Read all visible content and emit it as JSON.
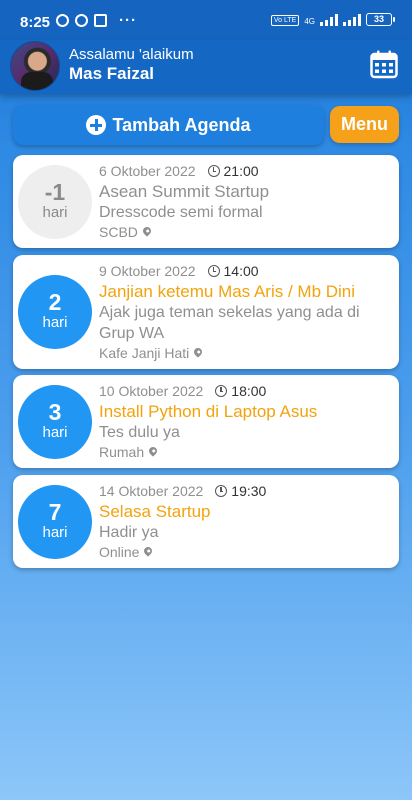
{
  "status_bar": {
    "time": "8:25",
    "network": "4G",
    "volte": "Vo LTE",
    "battery": "33"
  },
  "header": {
    "greeting": "Assalamu 'alaikum",
    "username": "Mas Faizal",
    "calendar_icon": "calendar-icon"
  },
  "actions": {
    "add_label": "Tambah Agenda",
    "menu_label": "Menu"
  },
  "agendas": [
    {
      "days": "-1",
      "unit": "hari",
      "date": "6 Oktober 2022",
      "time": "21:00",
      "title": "Asean Summit Startup",
      "description": "Dresscode semi formal",
      "location": "SCBD"
    },
    {
      "days": "2",
      "unit": "hari",
      "date": "9 Oktober 2022",
      "time": "14:00",
      "title": "Janjian ketemu Mas Aris / Mb Dini",
      "description": "Ajak juga teman sekelas yang ada di Grup WA",
      "location": "Kafe Janji Hati"
    },
    {
      "days": "3",
      "unit": "hari",
      "date": "10 Oktober 2022",
      "time": "18:00",
      "title": "Install Python di Laptop Asus",
      "description": "Tes dulu ya",
      "location": "Rumah"
    },
    {
      "days": "7",
      "unit": "hari",
      "date": "14 Oktober 2022",
      "time": "19:30",
      "title": "Selasa Startup",
      "description": "Hadir ya",
      "location": "Online"
    }
  ],
  "colors": {
    "primary": "#1567c4",
    "accent": "#f5a21a",
    "badge": "#2196f3",
    "title": "#f2a30d"
  }
}
